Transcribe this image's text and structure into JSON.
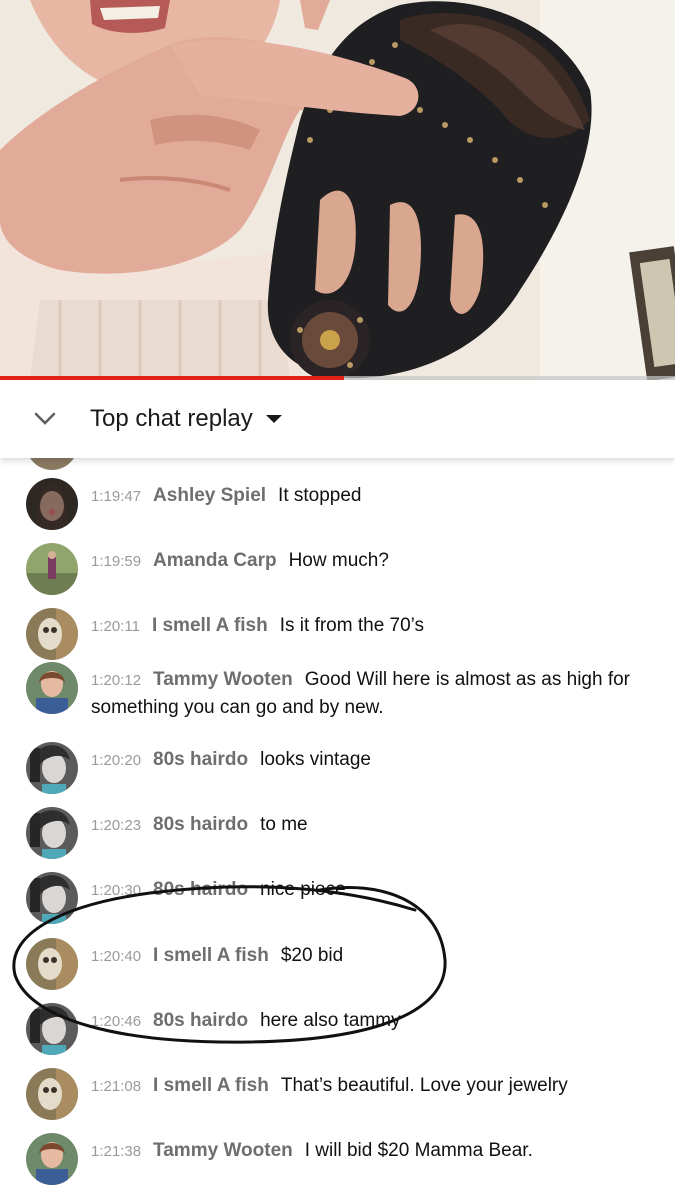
{
  "video": {
    "progress_fraction": 0.51
  },
  "chat": {
    "header_title": "Top chat replay",
    "collapse_icon": "chevron-down-icon",
    "dropdown_icon": "caret-down-icon",
    "accent_color": "#e62117",
    "messages": [
      {
        "time": "1:19:47",
        "author": "Ashley Spiel",
        "text": "It stopped",
        "avatar": "ashley"
      },
      {
        "time": "1:19:59",
        "author": "Amanda Carp",
        "text": "How much?",
        "avatar": "amanda"
      },
      {
        "time": "1:20:11",
        "author": "I smell A fish",
        "text": "Is it from the 70’s",
        "avatar": "fish"
      },
      {
        "time": "1:20:12",
        "author": "Tammy Wooten",
        "text": "Good Will here is almost as as high for something you can go and by new.",
        "avatar": "tammy"
      },
      {
        "time": "1:20:20",
        "author": "80s hairdo",
        "text": "looks vintage",
        "avatar": "hairdo"
      },
      {
        "time": "1:20:23",
        "author": "80s hairdo",
        "text": "to me",
        "avatar": "hairdo"
      },
      {
        "time": "1:20:30",
        "author": "80s hairdo",
        "text": "nice piece",
        "avatar": "hairdo"
      },
      {
        "time": "1:20:40",
        "author": "I smell A fish",
        "text": "$20 bid",
        "avatar": "fish"
      },
      {
        "time": "1:20:46",
        "author": "80s hairdo",
        "text": "here also tammy",
        "avatar": "hairdo"
      },
      {
        "time": "1:21:08",
        "author": "I smell A fish",
        "text": "That’s beautiful. Love your jewelry",
        "avatar": "fish"
      },
      {
        "time": "1:21:38",
        "author": "Tammy Wooten",
        "text": "I will bid $20 Mamma Bear.",
        "avatar": "tammy"
      }
    ]
  }
}
